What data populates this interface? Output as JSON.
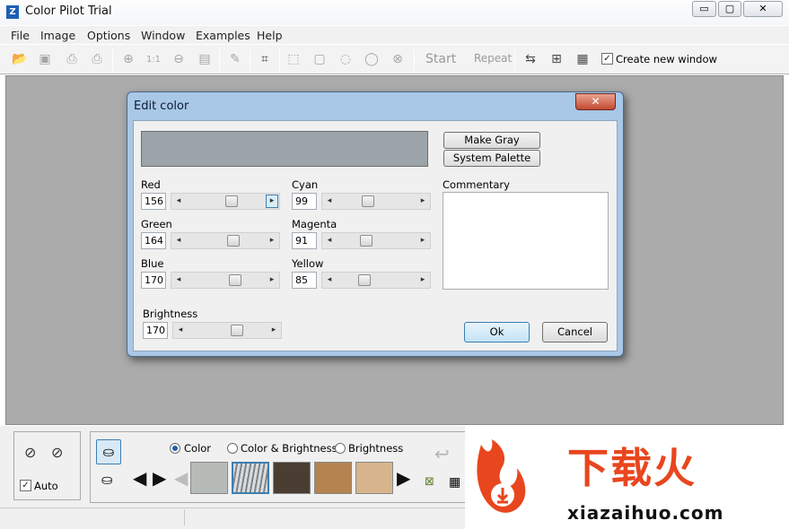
{
  "window": {
    "title": "Color Pilot Trial",
    "min": "▭",
    "max": "▢",
    "close": "✕"
  },
  "menu": [
    "File",
    "Image",
    "Options",
    "Window",
    "Examples",
    "Help"
  ],
  "toolbar": {
    "start": "Start",
    "repeat": "Repeat",
    "create_new_window_label": "Create new window",
    "create_new_window_checked": true,
    "zoom_label": "1:1"
  },
  "dialog": {
    "title": "Edit color",
    "swatch_color": "#9ca4aa",
    "make_gray": "Make Gray",
    "system_palette": "System Palette",
    "commentary_label": "Commentary",
    "commentary_value": "",
    "channels": {
      "red": {
        "label": "Red",
        "value": "156"
      },
      "green": {
        "label": "Green",
        "value": "164"
      },
      "blue": {
        "label": "Blue",
        "value": "170"
      },
      "cyan": {
        "label": "Cyan",
        "value": "99"
      },
      "magenta": {
        "label": "Magenta",
        "value": "91"
      },
      "yellow": {
        "label": "Yellow",
        "value": "85"
      },
      "brightness": {
        "label": "Brightness",
        "value": "170"
      }
    },
    "ok": "Ok",
    "cancel": "Cancel"
  },
  "bottom": {
    "auto_label": "Auto",
    "auto_checked": true,
    "modes": [
      {
        "label": "Color",
        "selected": true
      },
      {
        "label": "Color & Brightness",
        "selected": false
      },
      {
        "label": "Brightness",
        "selected": false
      }
    ],
    "thumbnails": [
      "#b7bbb8",
      "#d9dcde",
      "#4a3e33",
      "#b4834f",
      "#d8b48c"
    ]
  },
  "watermark": {
    "cn": "下载火",
    "url": "xiazaihuo.com"
  },
  "colors": {
    "accent": "#3c7fb1",
    "watermark_red": "#e8461e"
  }
}
